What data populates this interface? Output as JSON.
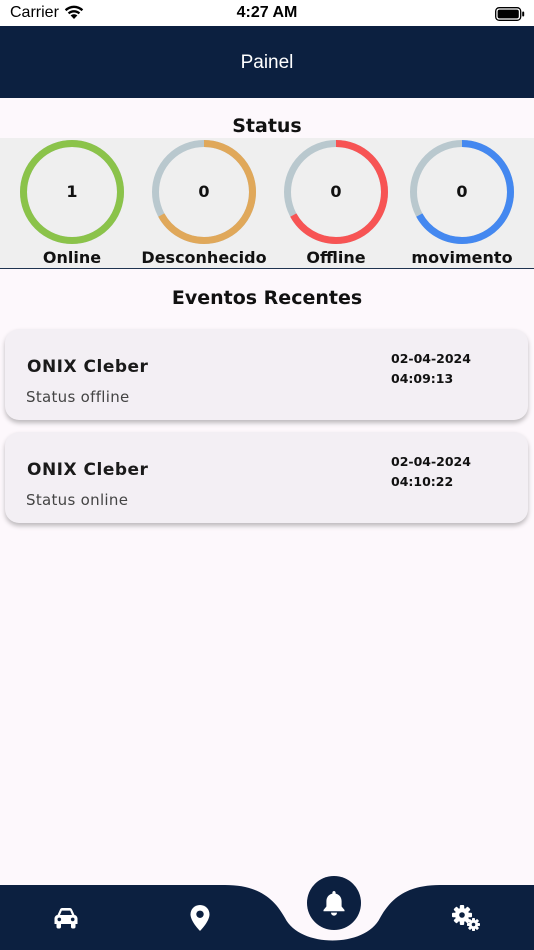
{
  "status_bar": {
    "carrier": "Carrier",
    "time": "4:27 AM"
  },
  "app_bar": {
    "title": "Painel"
  },
  "status_section": {
    "title": "Status",
    "gauges": [
      {
        "label": "Online",
        "value": "1",
        "color": "#8bc34a",
        "fraction": 1.0
      },
      {
        "label": "Desconhecido",
        "value": "0",
        "color": "#e0a85a",
        "fraction": 0.67
      },
      {
        "label": "Offline",
        "value": "0",
        "color": "#f75454",
        "fraction": 0.67
      },
      {
        "label": "movimento",
        "value": "0",
        "color": "#4488f0",
        "fraction": 0.67
      }
    ],
    "track_color": "#b9c8ce"
  },
  "events_section": {
    "title": "Eventos Recentes",
    "events": [
      {
        "name": "ONIX Cleber",
        "status": "Status offline",
        "date": "02-04-2024",
        "time": "04:09:13"
      },
      {
        "name": "ONIX Cleber",
        "status": "Status online",
        "date": "02-04-2024",
        "time": "04:10:22"
      }
    ]
  },
  "bottom_nav": {
    "items": [
      "car-icon",
      "location-pin-icon",
      "bell-icon",
      "settings-gears-icon"
    ],
    "active": "bell-icon",
    "background": "#0c2040"
  }
}
